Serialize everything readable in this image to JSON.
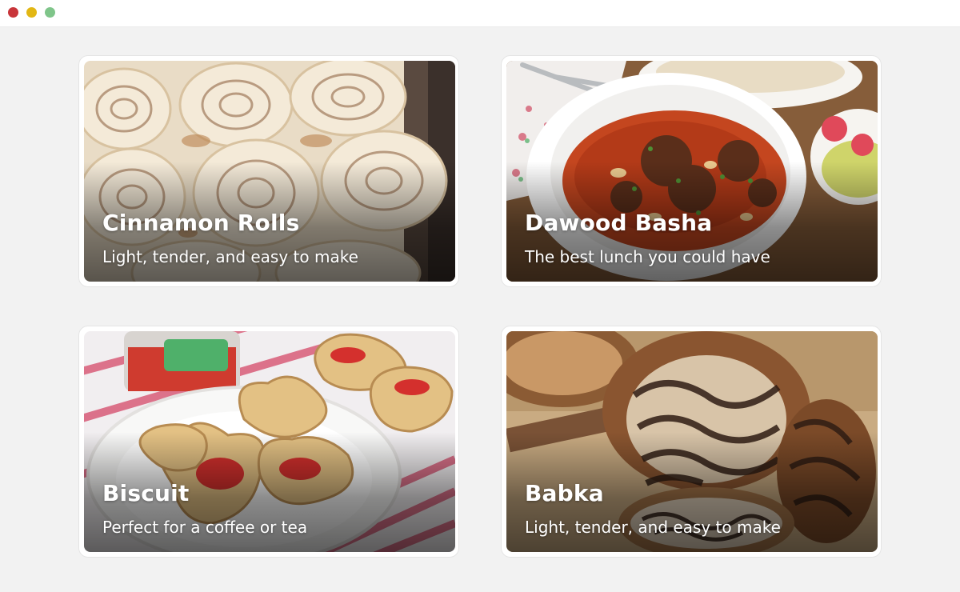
{
  "cards": [
    {
      "title": "Cinnamon Rolls",
      "subtitle": "Light, tender, and easy to make"
    },
    {
      "title": "Dawood Basha",
      "subtitle": "The best lunch you could have"
    },
    {
      "title": "Biscuit",
      "subtitle": "Perfect for a coffee or tea"
    },
    {
      "title": "Babka",
      "subtitle": "Light, tender, and easy to make"
    }
  ],
  "colors": {
    "window_close": "#c8353a",
    "window_minimize": "#e2b714",
    "window_maximize": "#7fc58a",
    "background": "#f2f2f2",
    "card_text": "#ffffff"
  }
}
